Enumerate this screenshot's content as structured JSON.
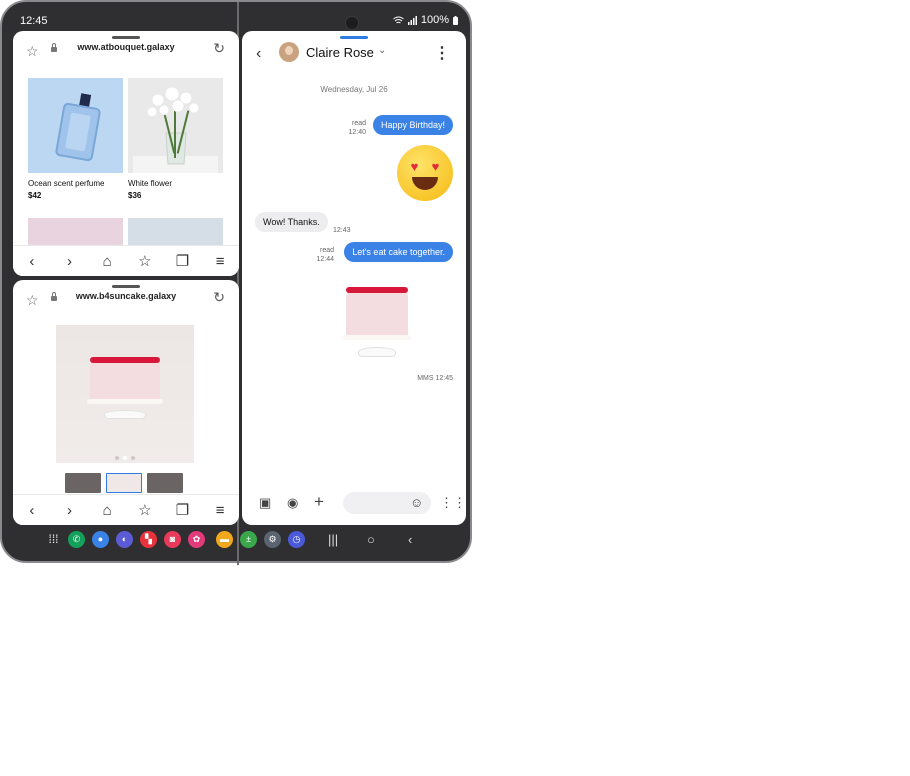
{
  "status": {
    "time": "12:45",
    "battery": "100%"
  },
  "browser_top": {
    "url": "www.atbouquet.galaxy",
    "products": [
      {
        "name": "Ocean scent perfume",
        "price": "$42"
      },
      {
        "name": "White flower",
        "price": "$36"
      }
    ]
  },
  "browser_bottom": {
    "url": "www.b4suncake.galaxy"
  },
  "messages": {
    "contact": "Claire Rose",
    "date": "Wednesday, Jul 26",
    "items": [
      {
        "text": "Happy Birthday!",
        "status": "read",
        "time": "12:40"
      },
      {
        "text": "Wow! Thanks.",
        "time": "12:43"
      },
      {
        "text": "Let's eat cake together.",
        "status": "read",
        "time": "12:44"
      }
    ],
    "mms_meta": "MMS 12:45"
  },
  "colors": {
    "accent": "#3b82e6",
    "frame": "#2f2f31",
    "cake_cherry": "#d7183a"
  },
  "icons": {
    "browser_nav": [
      "back-icon",
      "forward-icon",
      "home-icon",
      "bookmark-icon",
      "tabs-icon",
      "menu-icon"
    ],
    "composer": [
      "gallery-icon",
      "camera-icon",
      "add-icon",
      "emoji-icon",
      "voice-icon"
    ],
    "dock_apps": [
      "apps-grid-icon",
      "phone-icon",
      "messages-icon",
      "internet-icon",
      "flipboard-icon",
      "camera-app-icon",
      "bixby-icon",
      "files-icon",
      "calculator-icon",
      "settings-icon",
      "clock-icon"
    ]
  }
}
